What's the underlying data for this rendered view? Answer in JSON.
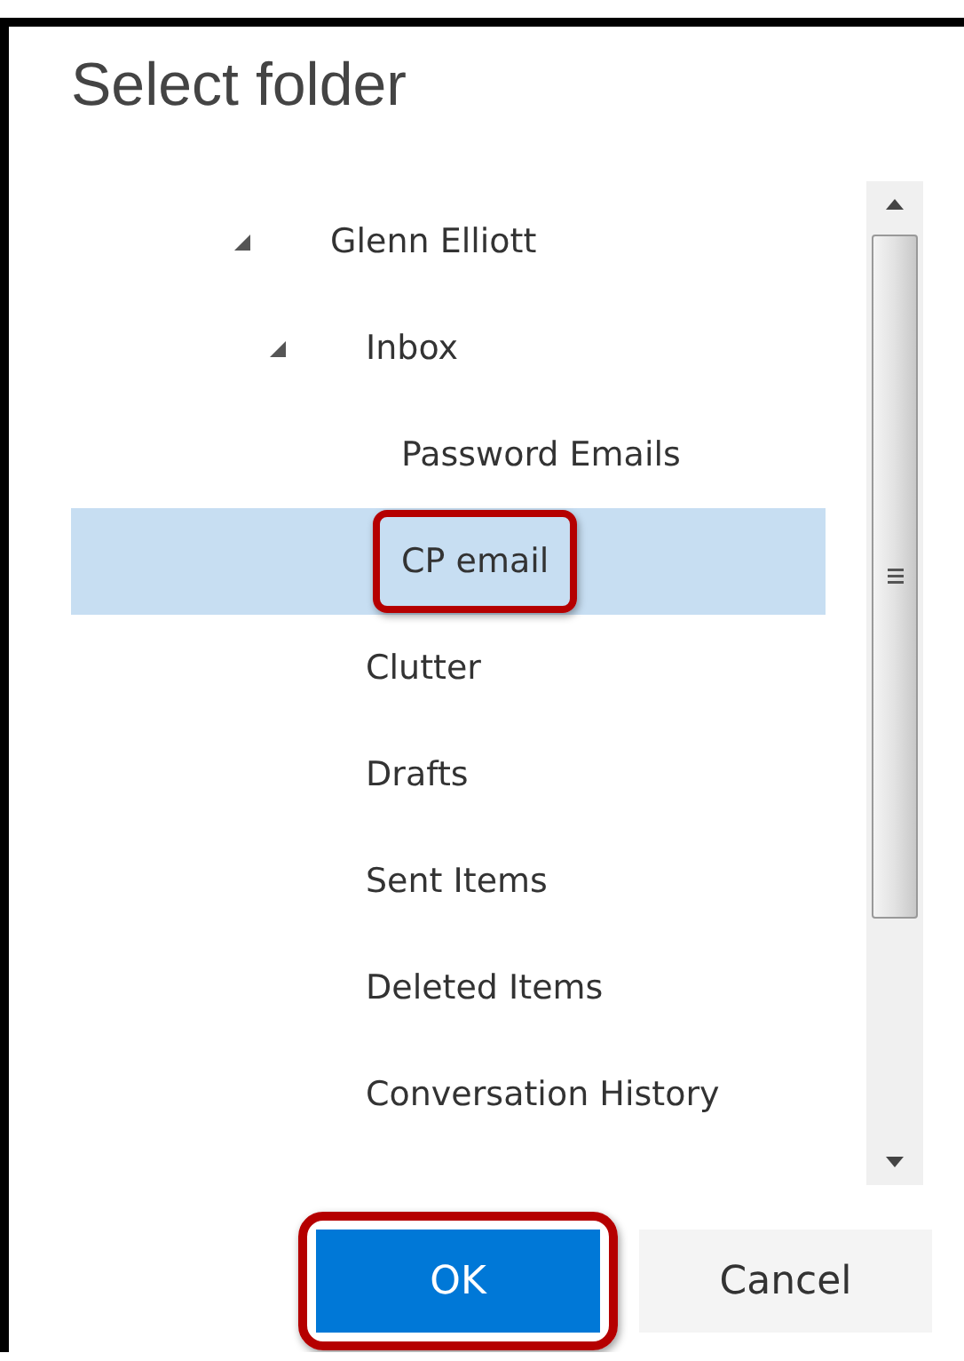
{
  "dialog": {
    "title": "Select folder"
  },
  "folders": [
    {
      "name": "Glenn Elliott",
      "expanded": true,
      "selected": false,
      "highlighted": false,
      "children": [
        {
          "name": "Inbox",
          "expanded": true,
          "selected": false,
          "highlighted": false,
          "children": [
            {
              "name": "Password Emails",
              "selected": false,
              "highlighted": false
            },
            {
              "name": "CP email",
              "selected": true,
              "highlighted": true
            }
          ]
        },
        {
          "name": "Clutter",
          "selected": false,
          "highlighted": false
        },
        {
          "name": "Drafts",
          "selected": false,
          "highlighted": false
        },
        {
          "name": "Sent Items",
          "selected": false,
          "highlighted": false
        },
        {
          "name": "Deleted Items",
          "selected": false,
          "highlighted": false
        },
        {
          "name": "Conversation History",
          "selected": false,
          "highlighted": false
        }
      ]
    }
  ],
  "buttons": [
    {
      "label": "OK",
      "kind": "primary",
      "highlighted": true
    },
    {
      "label": "Cancel",
      "kind": "secondary",
      "highlighted": false
    }
  ]
}
